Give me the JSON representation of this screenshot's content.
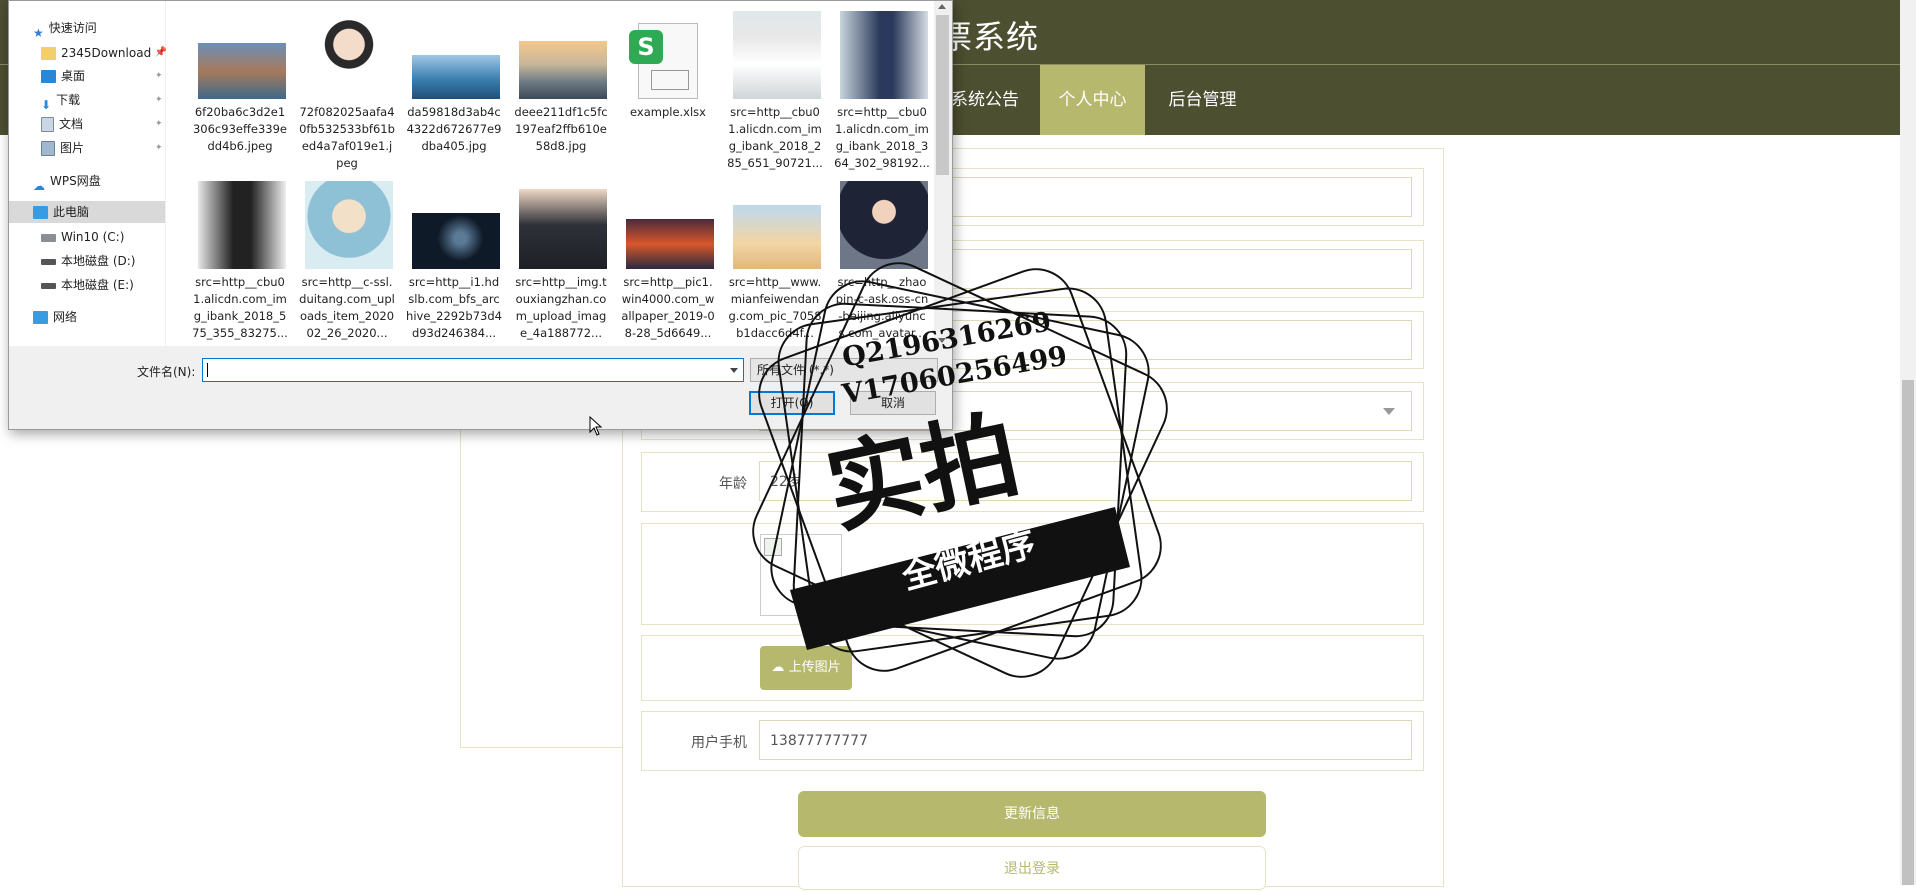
{
  "page": {
    "header_title": "票系统",
    "nav": [
      {
        "label": "系统公告",
        "active": false
      },
      {
        "label": "个人中心",
        "active": true
      },
      {
        "label": "后台管理",
        "active": false
      }
    ],
    "form": {
      "age_label": "年龄",
      "age_value": "22岁",
      "upload_label": "上传图片",
      "phone_label": "用户手机",
      "phone_value": "13877777777"
    },
    "buttons": {
      "update": "更新信息",
      "logout": "退出登录"
    },
    "colors": {
      "header_bg": "#4c4f30",
      "accent": "#b6b86e"
    }
  },
  "dialog": {
    "tree": [
      {
        "label": "快速访问",
        "icon": "star-icon"
      },
      {
        "label": "2345Download",
        "icon": "folder-icon"
      },
      {
        "label": "桌面",
        "icon": "desktop-icon"
      },
      {
        "label": "下载",
        "icon": "download-icon"
      },
      {
        "label": "文档",
        "icon": "document-icon"
      },
      {
        "label": "图片",
        "icon": "picture-icon"
      },
      {
        "label": "WPS网盘",
        "icon": "cloud-icon"
      },
      {
        "label": "此电脑",
        "icon": "computer-icon"
      },
      {
        "label": "Win10 (C:)",
        "icon": "drive-icon"
      },
      {
        "label": "本地磁盘 (D:)",
        "icon": "drive-icon"
      },
      {
        "label": "本地磁盘 (E:)",
        "icon": "drive-icon"
      },
      {
        "label": "网络",
        "icon": "network-icon"
      }
    ],
    "files": [
      {
        "name": "6f20ba6c3d2e1306c93effe339edd4b6.jpeg",
        "thumb": "coast-village"
      },
      {
        "name": "72f082025aafa40fb532533bf61bed4a7af019e1.jpeg",
        "thumb": "cartoon-boy"
      },
      {
        "name": "da59818d3ab4c4322d672677e9dba405.jpg",
        "thumb": "island-sea"
      },
      {
        "name": "deee211df1c5fc197eaf2ffb610e58d8.jpg",
        "thumb": "lake-sunset"
      },
      {
        "name": "example.xlsx",
        "thumb": "spreadsheet"
      },
      {
        "name": "src=http__cbu01.alicdn.com_img_ibank_2018_285_651_90721...",
        "thumb": "woman-white"
      },
      {
        "name": "src=http__cbu01.alicdn.com_img_ibank_2018_364_302_98192...",
        "thumb": "woman-navy"
      },
      {
        "name": "src=http__cbu01.alicdn.com_img_ibank_2018_575_355_83275...",
        "thumb": "woman-black"
      },
      {
        "name": "src=http__c-ssl.duitang.com_uploads_item_202002_26_2020...",
        "thumb": "cartoon-girl"
      },
      {
        "name": "src=http__i1.hdslb.com_bfs_archive_2292b73d4d93d246384...",
        "thumb": "dancer-dark"
      },
      {
        "name": "src=http__img.touxiangzhan.com_upload_image_4a188772...",
        "thumb": "man-suit"
      },
      {
        "name": "src=http__pic1.win4000.com_wallpaper_2019-08-28_5d6649...",
        "thumb": "red-sunset"
      },
      {
        "name": "src=http__www.mianfeiwendang.com_pic_7058b1dacc6d4f...",
        "thumb": "desert-sky"
      },
      {
        "name": "src=http__zhaopin-c-ask.oss-cn-beijing.aliyuncs.com_avatar...",
        "thumb": "woman-portrait"
      }
    ],
    "filename_label": "文件名(N):",
    "filename_value": "",
    "filetype": "所有文件 (*.*)",
    "open_button": "打开(O)",
    "cancel_button": "取消"
  },
  "watermark": {
    "line1": "Q2196316269",
    "line2": "V17060256499",
    "big": "实拍",
    "band": "全微程序"
  }
}
